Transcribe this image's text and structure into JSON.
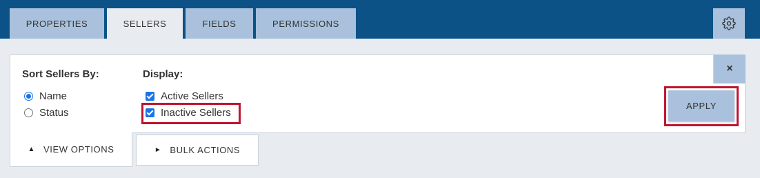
{
  "tabs": [
    {
      "label": "PROPERTIES",
      "active": false
    },
    {
      "label": "SELLERS",
      "active": true
    },
    {
      "label": "FIELDS",
      "active": false
    },
    {
      "label": "PERMISSIONS",
      "active": false
    }
  ],
  "settings_icon": "gear-icon",
  "panel": {
    "sort": {
      "heading": "Sort Sellers By:",
      "options": [
        {
          "label": "Name",
          "checked": true
        },
        {
          "label": "Status",
          "checked": false
        }
      ]
    },
    "display": {
      "heading": "Display:",
      "options": [
        {
          "label": "Active Sellers",
          "checked": true
        },
        {
          "label": "Inactive Sellers",
          "checked": true
        }
      ]
    },
    "close_label": "×",
    "apply_label": "APPLY"
  },
  "bottom_tabs": {
    "view_options": {
      "icon": "▲",
      "label": "VIEW OPTIONS"
    },
    "bulk_actions": {
      "icon": "►",
      "label": "BULK ACTIONS"
    }
  },
  "colors": {
    "header_bg": "#0c5287",
    "tab_bg": "#a9c1dc",
    "highlight": "#c0142e",
    "checkbox": "#1a73e8"
  }
}
